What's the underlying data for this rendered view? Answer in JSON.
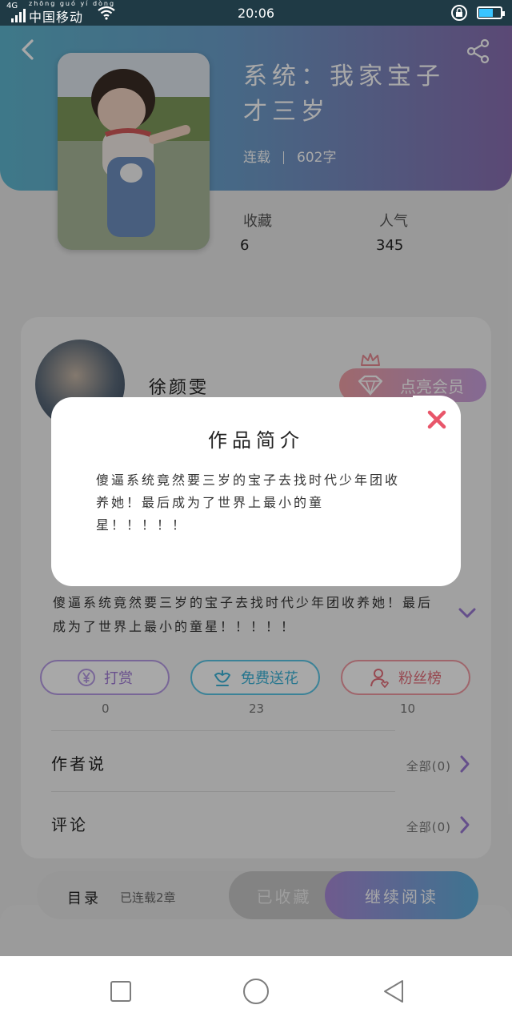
{
  "status_bar": {
    "network": "4G",
    "carrier_pinyin": "zhōng guó yí dòng",
    "carrier": "中国移动",
    "time": "20:06",
    "battery_level": 0.6
  },
  "book": {
    "title": "系统：我家宝子才三岁",
    "serial_status": "连载",
    "word_count": "602字",
    "favorites_label": "收藏",
    "favorites_value": "6",
    "popularity_label": "人气",
    "popularity_value": "345"
  },
  "author": {
    "name": "徐颜雯",
    "vip_label": "点亮会员"
  },
  "intro": {
    "text": "傻逼系统竟然要三岁的宝子去找时代少年团收养她！最后成为了世界上最小的童星！！！！！"
  },
  "actions": {
    "reward_label": "打赏",
    "reward_count": "0",
    "flower_label": "免费送花",
    "flower_count": "23",
    "fans_label": "粉丝榜",
    "fans_count": "10"
  },
  "sections": {
    "author_says": "作者说",
    "author_says_all": "全部(0)",
    "comments": "评论",
    "comments_all": "全部(0)"
  },
  "bottom_bar": {
    "catalog": "目录",
    "chapters": "已连载2章",
    "collected": "已收藏",
    "continue_reading": "继续阅读"
  },
  "modal": {
    "title": "作品简介",
    "body": "傻逼系统竟然要三岁的宝子去找时代少年团收养她！最后成为了世界上最小的童星！！！！！"
  },
  "icons": [
    "back-icon",
    "share-icon",
    "crown-icon",
    "gem-icon",
    "chevron-down-icon",
    "yen-icon",
    "flower-icon",
    "fans-icon",
    "arrow-right-icon",
    "close-icon"
  ],
  "colors": {
    "accent_purple": "#a07ad6",
    "accent_blue": "#3cb3d8",
    "accent_pink": "#e5707c",
    "close_red": "#e8566a"
  }
}
